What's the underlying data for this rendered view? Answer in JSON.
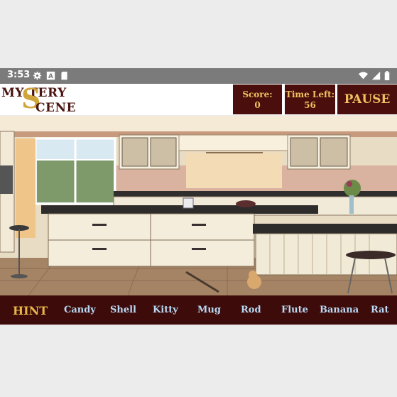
{
  "status_bar": {
    "time": "3:53",
    "left_icons": [
      "settings-icon",
      "a-icon",
      "sd-card-icon"
    ],
    "right_icons": [
      "wifi-icon",
      "signal-icon",
      "battery-icon"
    ]
  },
  "logo": {
    "line1": "MY  TERY",
    "line2": "CENE",
    "big_letter": "S"
  },
  "hud": {
    "score_label": "Score:",
    "score_value": "0",
    "time_label": "Time Left:",
    "time_value": "56",
    "pause_label": "PAUSE"
  },
  "bottom_bar": {
    "hint_label": "HINT",
    "items": [
      "Candy",
      "Shell",
      "Kitty",
      "Mug",
      "Rod",
      "Flute",
      "Banana",
      "Rat"
    ]
  },
  "colors": {
    "panel_bg": "#4a0f0c",
    "panel_text": "#f0c060",
    "item_text": "#b9d9f5",
    "hint_text": "#e8b74a"
  }
}
